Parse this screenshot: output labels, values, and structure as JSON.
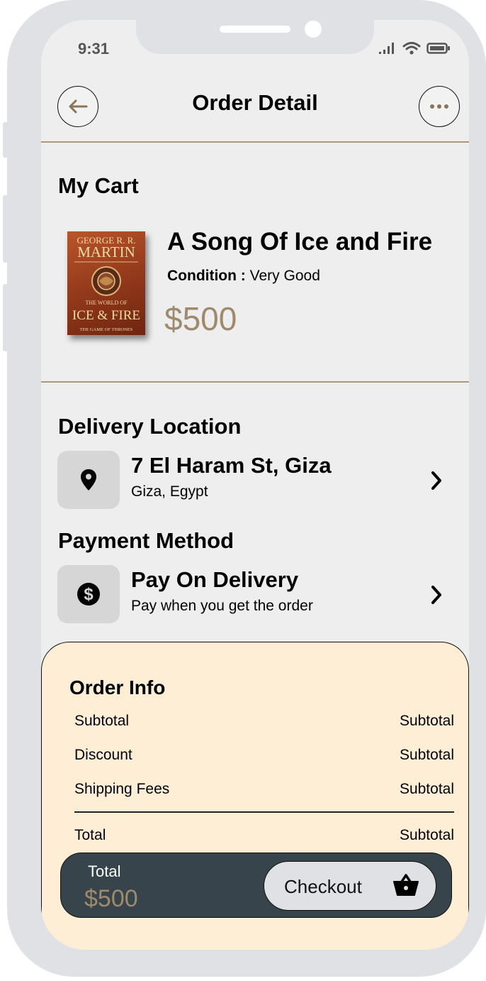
{
  "status_bar": {
    "time": "9:31"
  },
  "header": {
    "title": "Order Detail"
  },
  "cart": {
    "section_title": "My Cart",
    "item": {
      "title": "A Song Of Ice and Fire",
      "condition_label": "Condition :",
      "condition_value": "Very Good",
      "price": "$500",
      "cover": {
        "author_line1": "GEORGE R. R.",
        "author_line2": "MARTIN",
        "title_line1": "THE WORLD OF",
        "title_line2": "ICE & FIRE",
        "series": "THE GAME OF THRONES"
      }
    }
  },
  "delivery": {
    "section_title": "Delivery Location",
    "address": "7 El Haram St, Giza",
    "region": "Giza, Egypt",
    "icon": "location-pin-icon"
  },
  "payment": {
    "section_title": "Payment Method",
    "method": "Pay On Delivery",
    "description": "Pay when you get the order",
    "icon": "dollar-coin-icon"
  },
  "order_info": {
    "title": "Order Info",
    "rows": [
      {
        "label": "Subtotal",
        "value": "Subtotal"
      },
      {
        "label": "Discount",
        "value": "Subtotal"
      },
      {
        "label": "Shipping Fees",
        "value": "Subtotal"
      }
    ],
    "total": {
      "label": "Total",
      "value": "Subtotal"
    }
  },
  "checkout": {
    "total_label": "Total",
    "total_value": "$500",
    "button_label": "Checkout",
    "icon": "basket-icon"
  },
  "colors": {
    "accent": "#9e8a6c",
    "panel": "#fdeed5",
    "bar": "#37444b",
    "screen": "#eeeeee",
    "frame": "#dfe1e5"
  }
}
